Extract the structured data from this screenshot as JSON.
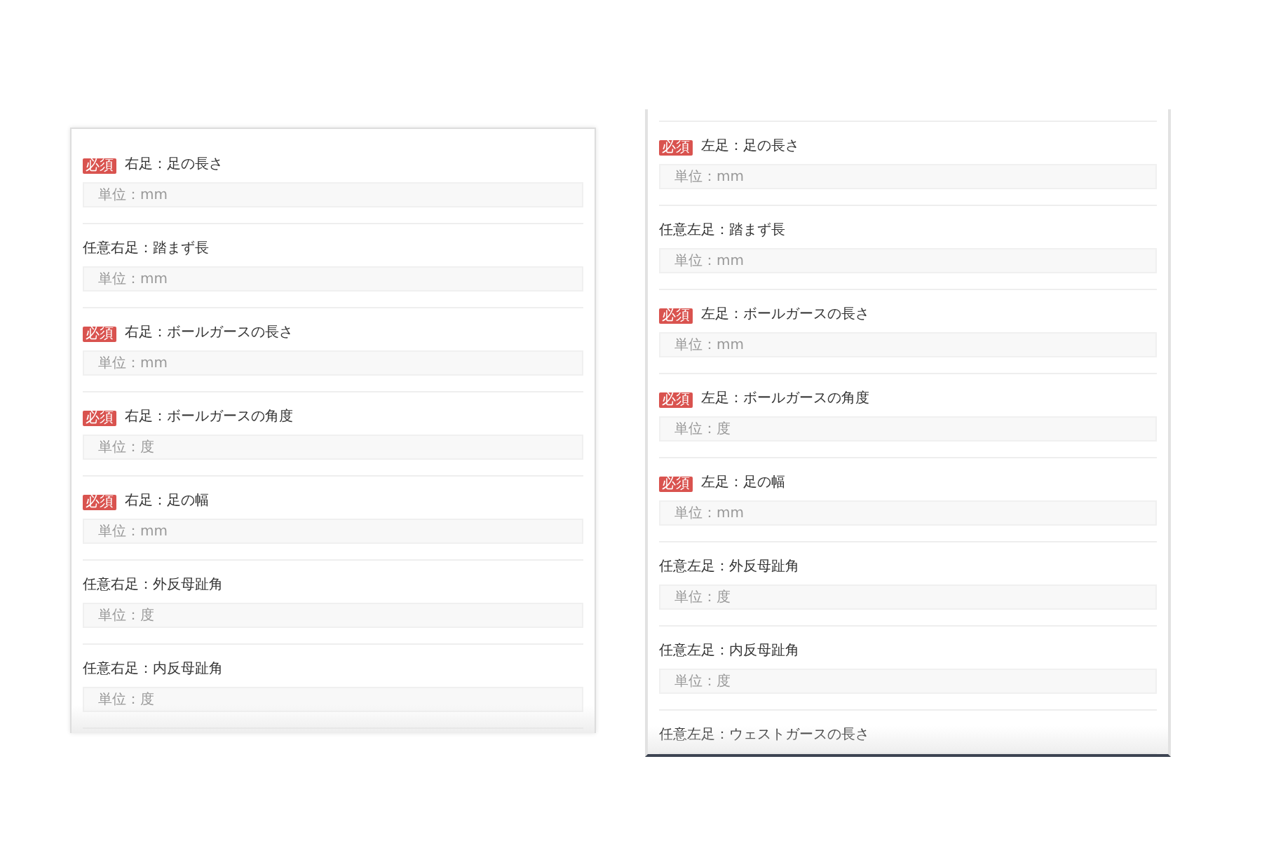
{
  "panels": [
    {
      "top_divider": false,
      "rows": [
        {
          "required": true,
          "badge": "必須",
          "label": "右足：足の長さ",
          "placeholder": "単位：mm"
        },
        {
          "required": false,
          "label": "任意右足：踏まず長",
          "placeholder": "単位：mm"
        },
        {
          "required": true,
          "badge": "必須",
          "label": "右足：ボールガースの長さ",
          "placeholder": "単位：mm"
        },
        {
          "required": true,
          "badge": "必須",
          "label": "右足：ボールガースの角度",
          "placeholder": "単位：度"
        },
        {
          "required": true,
          "badge": "必須",
          "label": "右足：足の幅",
          "placeholder": "単位：mm"
        },
        {
          "required": false,
          "label": "任意右足：外反母趾角",
          "placeholder": "単位：度"
        },
        {
          "required": false,
          "label": "任意右足：内反母趾角",
          "placeholder": "単位：度"
        }
      ]
    },
    {
      "top_divider": true,
      "rows": [
        {
          "required": true,
          "badge": "必須",
          "label": "左足：足の長さ",
          "placeholder": "単位：mm"
        },
        {
          "required": false,
          "label": "任意左足：踏まず長",
          "placeholder": "単位：mm"
        },
        {
          "required": true,
          "badge": "必須",
          "label": "左足：ボールガースの長さ",
          "placeholder": "単位：mm"
        },
        {
          "required": true,
          "badge": "必須",
          "label": "左足：ボールガースの角度",
          "placeholder": "単位：度"
        },
        {
          "required": true,
          "badge": "必須",
          "label": "左足：足の幅",
          "placeholder": "単位：mm"
        },
        {
          "required": false,
          "label": "任意左足：外反母趾角",
          "placeholder": "単位：度"
        },
        {
          "required": false,
          "label": "任意左足：内反母趾角",
          "placeholder": "単位：度"
        },
        {
          "required": false,
          "label": "任意左足：ウェストガースの長さ"
        }
      ]
    }
  ]
}
